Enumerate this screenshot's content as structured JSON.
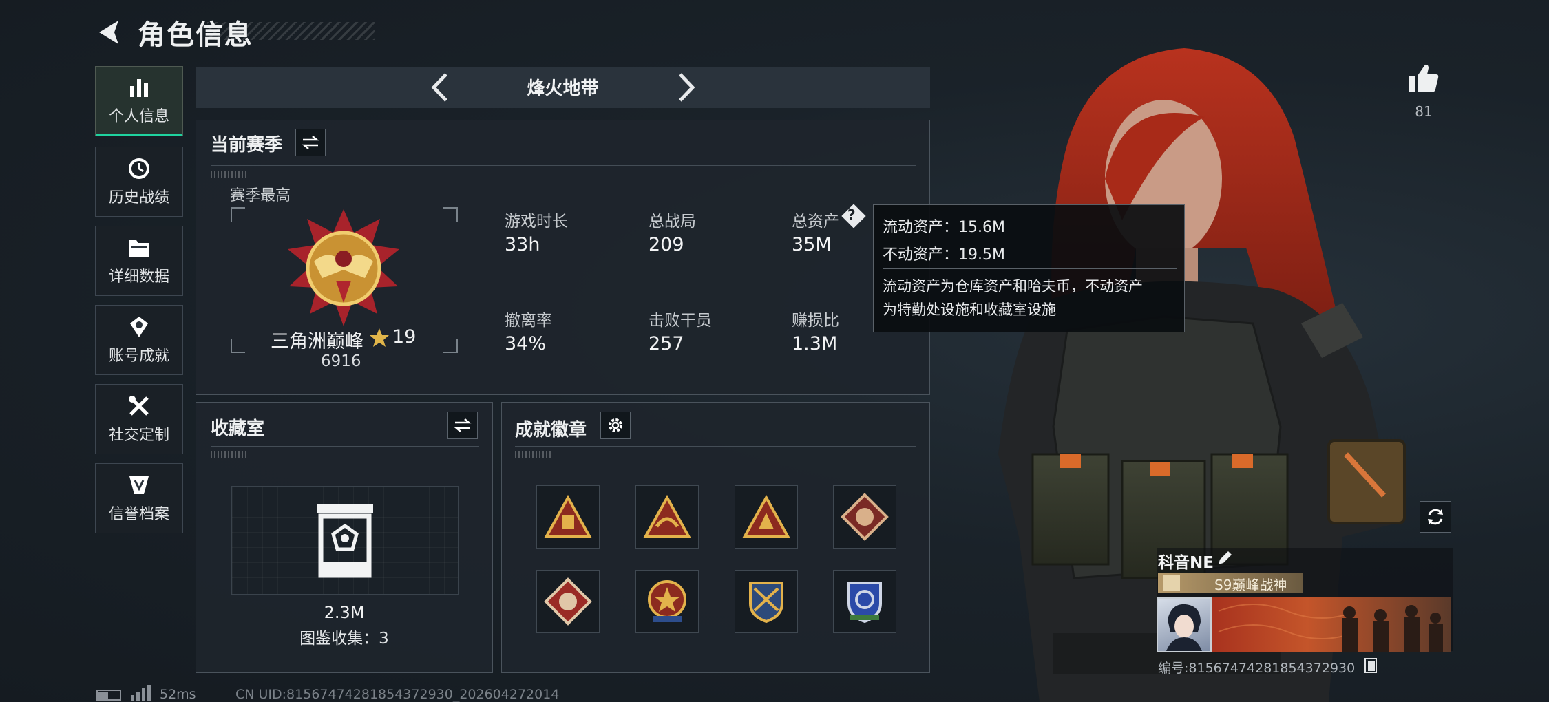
{
  "header": {
    "title": "角色信息"
  },
  "sidebar": {
    "items": [
      {
        "label": "个人信息",
        "icon": "bar-chart-icon",
        "active": true
      },
      {
        "label": "历史战绩",
        "icon": "history-icon"
      },
      {
        "label": "详细数据",
        "icon": "folder-icon"
      },
      {
        "label": "账号成就",
        "icon": "achievement-icon"
      },
      {
        "label": "社交定制",
        "icon": "tools-icon"
      },
      {
        "label": "信誉档案",
        "icon": "reputation-icon"
      }
    ]
  },
  "mode": {
    "title": "烽火地带"
  },
  "season": {
    "title": "当前赛季",
    "best_label": "赛季最高",
    "rank_name": "三角洲巅峰",
    "rank_stars": "19",
    "rank_score": "6916",
    "stats": [
      {
        "label": "游戏时长",
        "value": "33h"
      },
      {
        "label": "总战局",
        "value": "209"
      },
      {
        "label": "总资产",
        "value": "35M"
      },
      {
        "label": "撤离率",
        "value": "34%"
      },
      {
        "label": "击败干员",
        "value": "257"
      },
      {
        "label": "赚损比",
        "value": "1.3M"
      }
    ]
  },
  "tooltip": {
    "liquid": "流动资产：15.6M",
    "fixed": "不动资产：19.5M",
    "desc_1": "流动资产为仓库资产和哈夫币，不动资产",
    "desc_2": "为特勤处设施和收藏室设施"
  },
  "collection": {
    "title": "收藏室",
    "value": "2.3M",
    "count_text": "图鉴收集：3"
  },
  "achievements": {
    "title": "成就徽章",
    "badges": [
      "triangle-gold-badge",
      "triangle-eagle-badge",
      "triangle-wolf-badge",
      "diamond-raptor-badge",
      "diamond-raptor-red-badge",
      "star-shield-badge",
      "crossed-rifles-shield-badge",
      "blue-shield-badge"
    ]
  },
  "likes": {
    "count": "81"
  },
  "player": {
    "name": "科音NE",
    "title_badge": "S9巅峰战神",
    "id_text": "编号:815674742818543729​30"
  },
  "status": {
    "ping": "52ms",
    "uid": "CN UID:81567474281854372930_202604272014"
  },
  "colors": {
    "accent": "#1fd39f",
    "panel": "#1e252c",
    "gold": "#d9a53a"
  }
}
